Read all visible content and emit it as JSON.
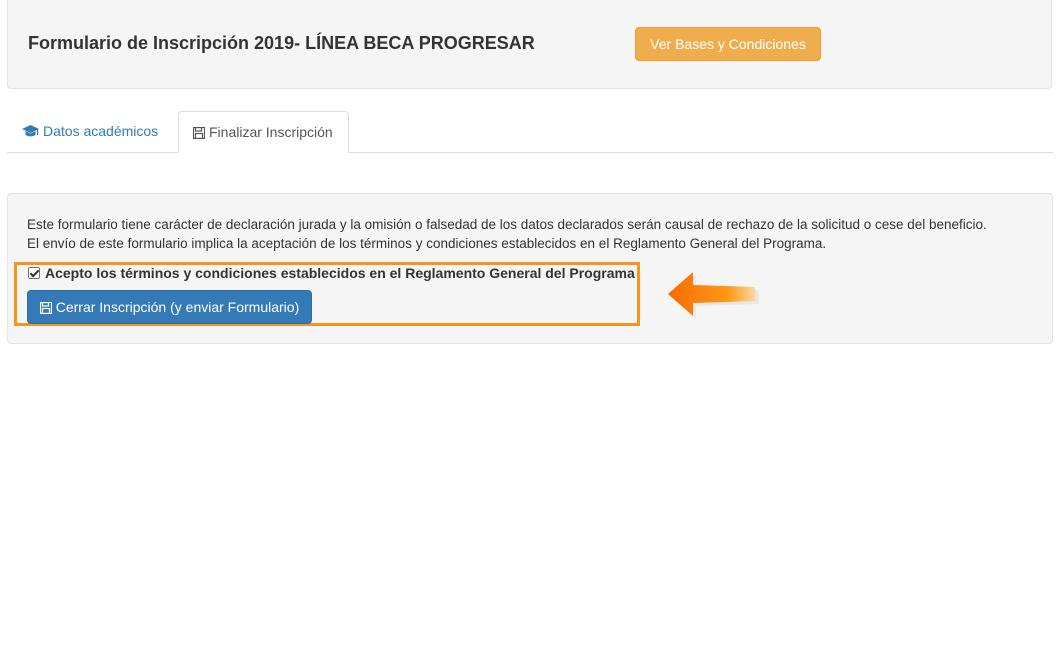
{
  "header": {
    "title": "Formulario de Inscripción 2019- LÍNEA BECA PROGRESAR",
    "bases_button": "Ver Bases y Condiciones"
  },
  "tabs": [
    {
      "label": "Datos académicos",
      "icon": "graduation-cap-icon",
      "active": false
    },
    {
      "label": "Finalizar Inscripción",
      "icon": "floppy-disk-icon",
      "active": true
    }
  ],
  "form": {
    "declaration_line1": "Este formulario tiene carácter de declaración jurada y la omisión o falsedad de los datos declarados serán causal de rechazo de la solicitud o cese del beneficio.",
    "declaration_line2": "El envío de este formulario implica la aceptación de los términos y condiciones establecidos en el Reglamento General del Programa.",
    "accept_label": "Acepto los términos y condiciones establecidos en el Reglamento General del Programa",
    "accept_checked": true,
    "submit_button": "Cerrar Inscripción (y enviar Formulario)",
    "submit_icon": "floppy-disk-icon"
  },
  "annotation": {
    "arrow_icon": "arrow-left-icon",
    "highlight_color": "#f7941d"
  },
  "colors": {
    "primary": "#337ab7",
    "warning": "#f0ad4e",
    "panel_bg": "#f5f5f5"
  }
}
